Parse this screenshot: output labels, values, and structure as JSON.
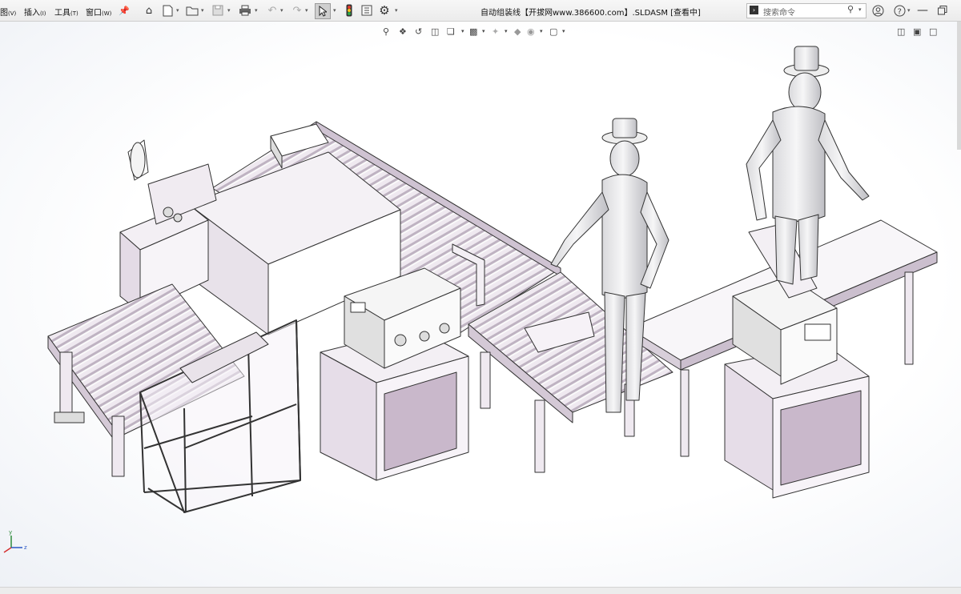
{
  "menu": {
    "view": "图",
    "view_key": "(V)",
    "insert": "插入",
    "insert_key": "(I)",
    "tools": "工具",
    "tools_key": "(T)",
    "window": "窗口",
    "window_key": "(W)"
  },
  "window_title": "自动组装线【开拔网www.386600.com】.SLDASM [查看中]",
  "search": {
    "placeholder": "搜索命令"
  },
  "colors": {
    "model_fill": "#e7dde8",
    "model_dark": "#c9b8cb",
    "model_line": "#3a3a3a",
    "toolbar_bg": "#f1f1f1"
  },
  "icons": [
    "home-icon",
    "new-document-icon",
    "open-folder-icon",
    "save-icon",
    "print-icon",
    "undo-icon",
    "redo-icon",
    "select-cursor-icon",
    "rebuild-light-icon",
    "file-properties-icon",
    "options-gear-icon",
    "search-icon",
    "help-icon",
    "question-icon",
    "minimize-icon",
    "restore-icon"
  ],
  "triad": {
    "x": "x",
    "y": "y",
    "z": "z"
  }
}
